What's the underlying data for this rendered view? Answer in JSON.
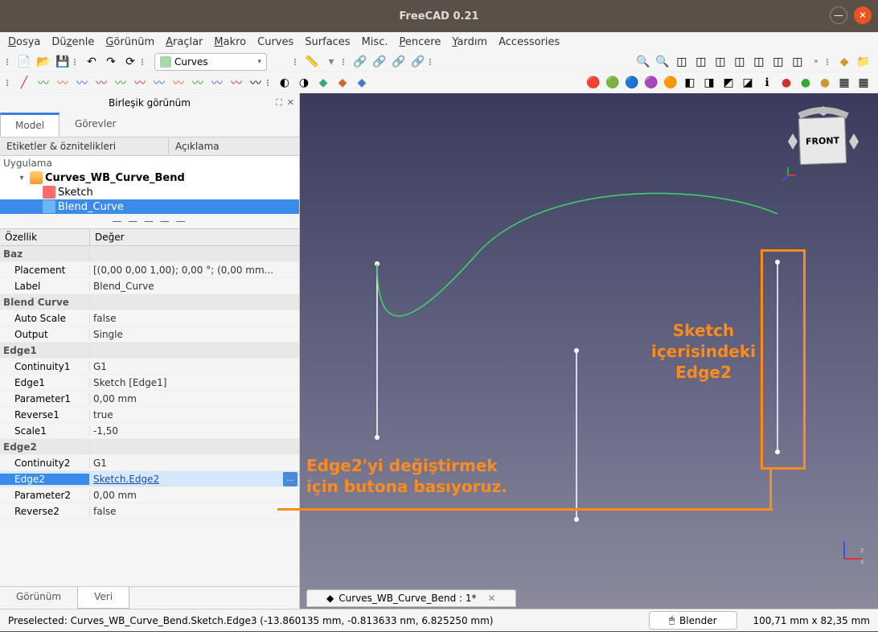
{
  "titlebar": {
    "title": "FreeCAD 0.21"
  },
  "menubar": [
    "Dosya",
    "Düzenle",
    "Görünüm",
    "Araçlar",
    "Makro",
    "Curves",
    "Surfaces",
    "Misc.",
    "Pencere",
    "Yardım",
    "Accessories"
  ],
  "workbench": {
    "label": "Curves"
  },
  "panel": {
    "title": "Birleşik görünüm",
    "tabs": {
      "model": "Model",
      "tasks": "Görevler"
    },
    "treeHeaders": {
      "labels": "Etiketler & öznitelikleri",
      "desc": "Açıklama"
    },
    "tree": {
      "app": "Uygulama",
      "doc": "Curves_WB_Curve_Bend",
      "sketch": "Sketch",
      "blend": "Blend_Curve"
    },
    "propsHeaders": {
      "name": "Özellik",
      "value": "Değer"
    },
    "groups": {
      "baz": "Baz",
      "blend": "Blend Curve",
      "edge1": "Edge1",
      "edge2": "Edge2"
    },
    "props": {
      "placement_n": "Placement",
      "placement_v": "[(0,00 0,00 1,00); 0,00 °; (0,00 mm...",
      "label_n": "Label",
      "label_v": "Blend_Curve",
      "autoscale_n": "Auto Scale",
      "autoscale_v": "false",
      "output_n": "Output",
      "output_v": "Single",
      "cont1_n": "Continuity1",
      "cont1_v": "G1",
      "edge1_n": "Edge1",
      "edge1_v": "Sketch [Edge1]",
      "param1_n": "Parameter1",
      "param1_v": "0,00 mm",
      "rev1_n": "Reverse1",
      "rev1_v": "true",
      "scale1_n": "Scale1",
      "scale1_v": "-1,50",
      "cont2_n": "Continuity2",
      "cont2_v": "G1",
      "edge2_n": "Edge2",
      "edge2_v": "Sketch.Edge2",
      "param2_n": "Parameter2",
      "param2_v": "0,00 mm",
      "rev2_n": "Reverse2",
      "rev2_v": "false"
    },
    "bottomTabs": {
      "view": "Görünüm",
      "data": "Veri"
    }
  },
  "viewport": {
    "docTab": "Curves_WB_Curve_Bend : 1*",
    "navFace": "FRONT",
    "annotation1": "Edge2'yi değiştirmek\niçin butona basıyoruz.",
    "annotation1_l1": "Edge2'yi değiştirmek",
    "annotation1_l2": "için butona basıyoruz.",
    "annotation2_l1": "Sketch",
    "annotation2_l2": "içerisindeki",
    "annotation2_l3": "Edge2"
  },
  "status": {
    "preselect": "Preselected: Curves_WB_Curve_Bend.Sketch.Edge3 (-13.860135 mm, -0.813633 nm, 6.825250 mm)",
    "btn": "Blender",
    "dims": "100,71 mm x 82,35 mm"
  },
  "colors": {
    "accent": "#ff8c1a",
    "select": "#3b8beb"
  }
}
